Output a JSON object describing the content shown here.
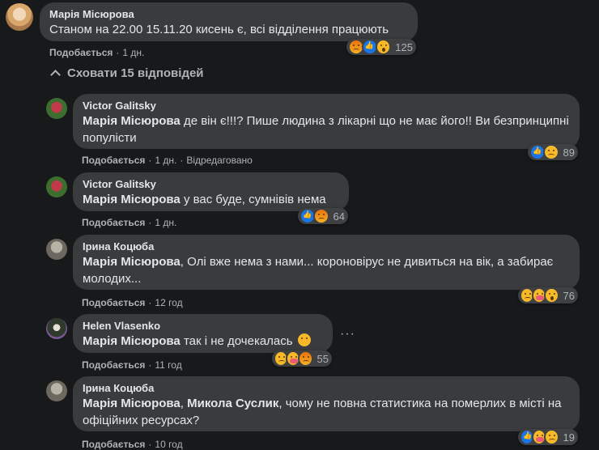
{
  "top_comment": {
    "author": "Марія Місюрова",
    "text": "Станом на 22.00 15.11.20 кисень є, всі відділення працюють",
    "like_label": "Подобається",
    "time": "1 дн.",
    "reactions": [
      "angry",
      "like",
      "wow"
    ],
    "reaction_count": "125"
  },
  "hide_replies_label": "Сховати 15 відповідей",
  "replies": [
    {
      "author": "Victor Galitsky",
      "mention": "Марія Місюрова",
      "text": " де він є!!!? Пише людина з лікарні що не має його!! Ви безпринципні популісти",
      "like_label": "Подобається",
      "time": "1 дн.",
      "edited": "Відредаговано",
      "reactions": [
        "like",
        "sad"
      ],
      "reaction_count": "89"
    },
    {
      "author": "Victor Galitsky",
      "mention": "Марія Місюрова",
      "text": " у вас буде, сумнівів нема",
      "like_label": "Подобається",
      "time": "1 дн.",
      "reactions": [
        "like",
        "angry"
      ],
      "reaction_count": "64"
    },
    {
      "author": "Ірина Коцюба",
      "mention": "Марія Місюрова",
      "text": ", Олі вже нема з нами... короновірус не дивиться на вік, а забирає молодих...",
      "like_label": "Подобається",
      "time": "12 год",
      "reactions": [
        "sad",
        "care",
        "wow"
      ],
      "reaction_count": "76"
    },
    {
      "author": "Helen Vlasenko",
      "mention": "Марія Місюрова",
      "text": " так і не дочекалась",
      "like_label": "Подобається",
      "time": "11 год",
      "reactions": [
        "sad",
        "care",
        "angry"
      ],
      "reaction_count": "55",
      "more_label": "···"
    },
    {
      "author": "Ірина Коцюба",
      "mention": "Марія Місюрова",
      "mention2": "Микола Суслик",
      "text": ", чому не повна статистика на померлих в місті на офіційних ресурсах?",
      "like_label": "Подобається",
      "time": "10 год",
      "reactions": [
        "like",
        "care",
        "sad"
      ],
      "reaction_count": "19"
    }
  ]
}
